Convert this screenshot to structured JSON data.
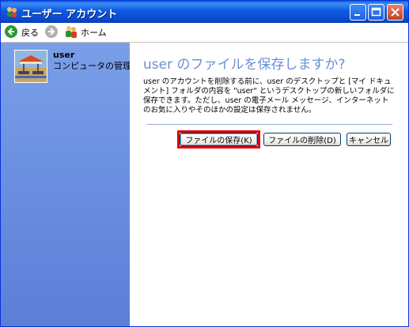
{
  "window": {
    "title": "ユーザー アカウント"
  },
  "nav": {
    "back_label": "戻る",
    "home_label": "ホーム"
  },
  "sidebar": {
    "user_name": "user",
    "user_role": "コンピュータの管理者"
  },
  "main": {
    "heading": "user のファイルを保存しますか?",
    "description": "user のアカウントを削除する前に、user のデスクトップと [マイ ドキュメント] フォルダの内容を \"user\" というデスクトップの新しいフォルダに保存できます。ただし、user の電子メール メッセージ、インターネットのお気に入りやそのほかの設定は保存されません。",
    "buttons": {
      "save": "ファイルの保存(K)",
      "delete": "ファイルの削除(D)",
      "cancel": "キャンセル"
    }
  },
  "colors": {
    "titlebar": "#0b4bd1",
    "sidebar": "#6a8ee0",
    "heading": "#6b8fd6",
    "highlight": "#e00000"
  },
  "icons": [
    "user-accounts-icon",
    "minimize-icon",
    "maximize-icon",
    "close-icon",
    "back-arrow-icon",
    "forward-arrow-icon",
    "home-users-icon"
  ]
}
